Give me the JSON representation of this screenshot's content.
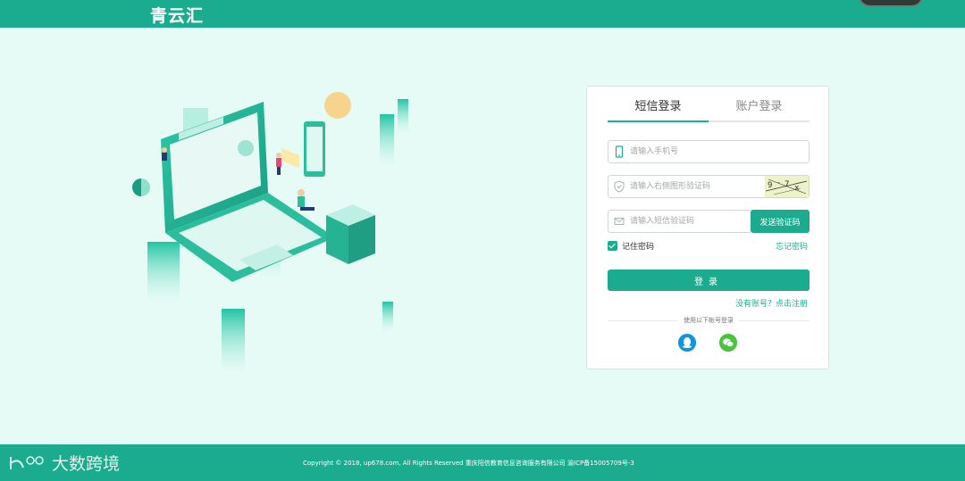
{
  "header": {
    "brand": "青云汇"
  },
  "login": {
    "tabs": [
      {
        "label": "短信登录",
        "active": true
      },
      {
        "label": "账户登录",
        "active": false
      }
    ],
    "phone_placeholder": "请输入手机号",
    "captcha_placeholder": "请输入右侧图形验证码",
    "sms_placeholder": "请输入短信验证码",
    "send_sms_label": "发送验证码",
    "remember_label": "记住密码",
    "remember_checked": true,
    "forgot_label": "忘记密码",
    "submit_label": "登录",
    "register_label": "没有账号？点击注册",
    "alt_login_label": "使用以下帐号登录",
    "social": [
      "qq-icon",
      "wechat-icon"
    ]
  },
  "footer": {
    "copyright": "Copyright © 2018, up678.com, All Rights Reserved 重庆阳信教育信息咨询服务有限公司 渝ICP备15005709号-3",
    "watermark": "大数跨境"
  },
  "colors": {
    "accent": "#1bac8f",
    "background": "#e7fbf6",
    "card": "#ffffff"
  }
}
